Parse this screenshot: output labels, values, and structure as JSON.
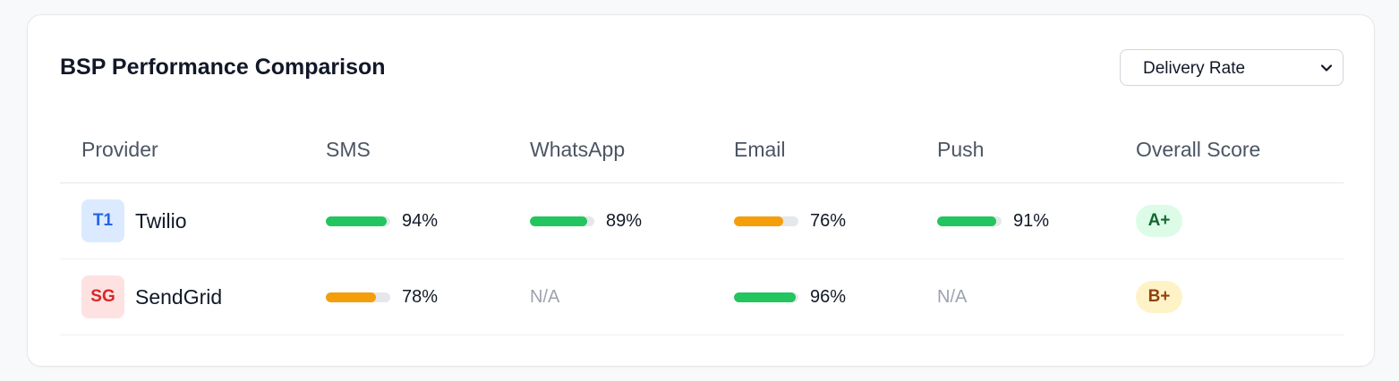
{
  "card": {
    "title": "BSP Performance Comparison"
  },
  "metric_select": {
    "value": "Delivery Rate",
    "icon": "chevron-down-icon"
  },
  "table": {
    "headers": [
      "Provider",
      "SMS",
      "WhatsApp",
      "Email",
      "Push",
      "Overall Score"
    ],
    "rows": [
      {
        "avatar": "T1",
        "avatar_bg": "#dbeafe",
        "avatar_color": "#2563eb",
        "name": "Twilio",
        "sms": {
          "label": "94%",
          "value": 0.94,
          "color": "#22c55e"
        },
        "whatsapp": {
          "label": "89%",
          "value": 0.89,
          "color": "#22c55e"
        },
        "email": {
          "label": "76%",
          "value": 0.76,
          "color": "#f59e0b"
        },
        "push": {
          "label": "91%",
          "value": 0.91,
          "color": "#22c55e"
        },
        "score": "A+",
        "score_bg": "#dcfce7",
        "score_color": "#166534"
      },
      {
        "avatar": "SG",
        "avatar_bg": "#fee2e2",
        "avatar_color": "#dc2626",
        "name": "SendGrid",
        "sms": {
          "label": "78%",
          "value": 0.78,
          "color": "#f59e0b"
        },
        "whatsapp": {
          "label": "N/A",
          "value": null,
          "color": ""
        },
        "email": {
          "label": "96%",
          "value": 0.96,
          "color": "#22c55e"
        },
        "push": {
          "label": "N/A",
          "value": null,
          "color": ""
        },
        "score": "B+",
        "score_bg": "#fef3c7",
        "score_color": "#92400e"
      }
    ]
  }
}
